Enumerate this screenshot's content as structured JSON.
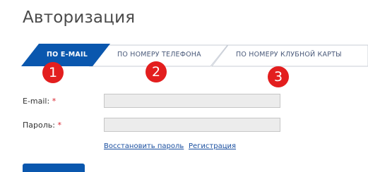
{
  "page": {
    "title": "Авторизация"
  },
  "tabs": [
    {
      "label": "ПО E-MAIL",
      "active": true
    },
    {
      "label": "ПО НОМЕРУ ТЕЛЕФОНА",
      "active": false
    },
    {
      "label": "ПО НОМЕРУ КЛУБНОЙ КАРТЫ",
      "active": false
    }
  ],
  "badges": [
    "1",
    "2",
    "3"
  ],
  "form": {
    "email_label": "E-mail:",
    "password_label": "Пароль:",
    "required_mark": "*",
    "email_value": "",
    "password_value": ""
  },
  "links": {
    "restore": "Восстановить пароль",
    "register": "Регистрация"
  },
  "colors": {
    "accent": "#0a57ae",
    "badge": "#e31e1e",
    "required": "#d9232e",
    "link": "#1a4fa0"
  }
}
